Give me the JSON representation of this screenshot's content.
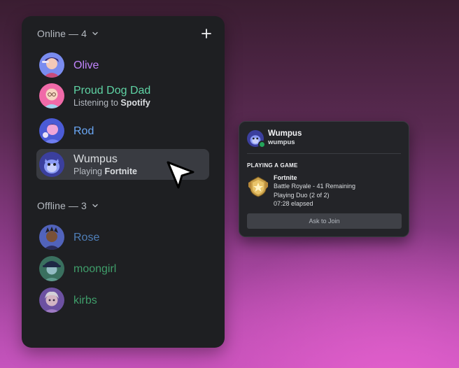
{
  "colors": {
    "olive": "#c084fc",
    "proud_dog_dad": "#5fd3a4",
    "rod": "#6aa7f5",
    "wumpus": "#dbdee1",
    "rose": "#4f7fb8",
    "moongirl": "#3f9d6a",
    "kirbs": "#3f9d6a",
    "online_dot": "#23a55a"
  },
  "online_section": {
    "label": "Online — 4",
    "add_icon": "plus-icon"
  },
  "offline_section": {
    "label": "Offline — 3"
  },
  "online_members": [
    {
      "name": "Olive",
      "status": "",
      "status_game": ""
    },
    {
      "name": "Proud Dog Dad",
      "status": "Listening to ",
      "status_game": "Spotify"
    },
    {
      "name": "Rod",
      "status": "",
      "status_game": ""
    },
    {
      "name": "Wumpus",
      "status": "Playing ",
      "status_game": "Fortnite"
    }
  ],
  "offline_members": [
    {
      "name": "Rose"
    },
    {
      "name": "moongirl"
    },
    {
      "name": "kirbs"
    }
  ],
  "popout": {
    "display_name": "Wumpus",
    "username": "wumpus",
    "section_title": "PLAYING A GAME",
    "game_title": "Fortnite",
    "game_details": "Battle Royale - 41 Remaining",
    "game_state": "Playing Duo (2 of 2)",
    "elapsed": "07:28 elapsed",
    "join_label": "Ask to Join"
  }
}
